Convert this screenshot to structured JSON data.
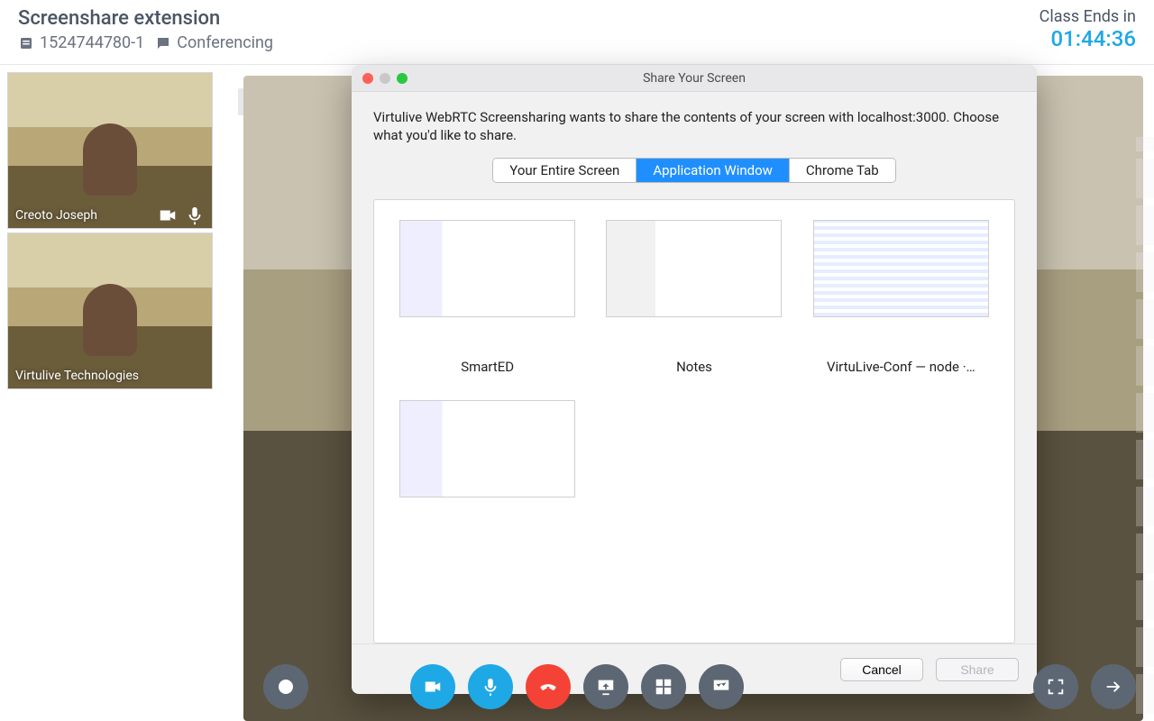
{
  "header": {
    "title": "Screenshare extension",
    "session_id": "1524744780-1",
    "section": "Conferencing",
    "ends_label": "Class Ends in",
    "countdown": "01:44:36"
  },
  "participants": [
    {
      "name": "Creoto Joseph",
      "has_cam": true,
      "has_mic": true
    },
    {
      "name": "Virtulive Technologies",
      "has_cam": false,
      "has_mic": false
    }
  ],
  "collapse_glyph": "‹",
  "dialog": {
    "title": "Share Your Screen",
    "message": "Virtulive WebRTC Screensharing wants to share the contents of your screen with localhost:3000. Choose what you'd like to share.",
    "tabs": [
      "Your Entire Screen",
      "Application Window",
      "Chrome Tab"
    ],
    "active_tab_index": 1,
    "windows": [
      {
        "label": "SmartED",
        "thumb_class": "app1"
      },
      {
        "label": "Notes",
        "thumb_class": "app2"
      },
      {
        "label": "VirtuLive-Conf — node ·…",
        "thumb_class": "app3"
      },
      {
        "label": "",
        "thumb_class": "app1"
      }
    ],
    "cancel": "Cancel",
    "share": "Share",
    "share_disabled": true
  },
  "toolbar": {
    "record": "record",
    "video": "video",
    "mic": "microphone",
    "hangup": "hang-up",
    "share": "screenshare",
    "grid": "layout-grid",
    "board": "whiteboard",
    "full": "fullscreen",
    "next": "next"
  }
}
